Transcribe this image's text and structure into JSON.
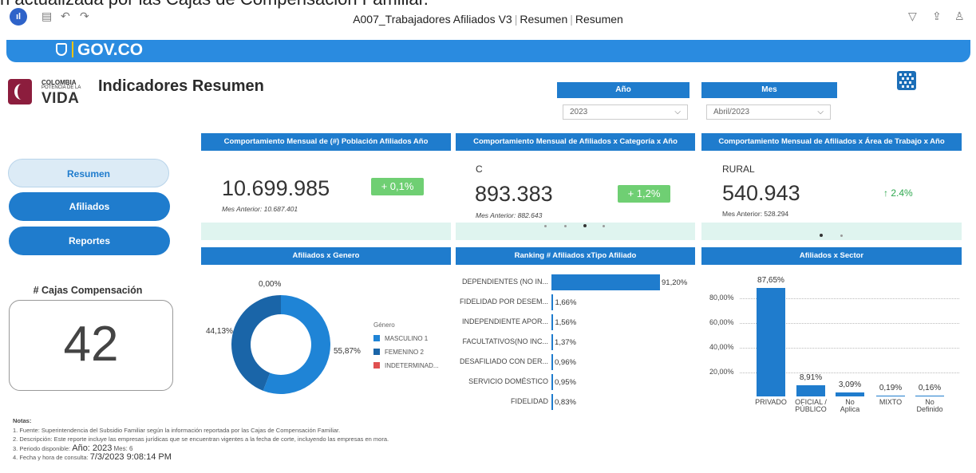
{
  "caption_fragment": "n actualizada por las Cajas de Compensacion Familiar.",
  "window": {
    "title": "A007_Trabajadores Afiliados V3",
    "crumb1": "Resumen",
    "crumb2": "Resumen",
    "app_icon": "app-logo-icon"
  },
  "gov": {
    "logo_text": "GOV.CO"
  },
  "brand": {
    "line1": "COLOMBIA",
    "line2": "POTENCIA DE LA",
    "line3": "VIDA"
  },
  "page_title": "Indicadores Resumen",
  "filters": {
    "year": {
      "label": "Año",
      "value": "2023"
    },
    "month": {
      "label": "Mes",
      "value": "Abril/2023"
    }
  },
  "nav": {
    "resumen": "Resumen",
    "afiliados": "Afiliados",
    "reportes": "Reportes"
  },
  "cajas": {
    "label": "# Cajas Compensación",
    "value": "42"
  },
  "kpi1": {
    "title": "Comportamiento Mensual de (#) Población  Afiliados Año",
    "value": "10.699.985",
    "delta": "+ 0,1%",
    "previous": "Mes Anterior: 10.687.401"
  },
  "kpi2": {
    "title": "Comportamiento Mensual de Afiliados x Categoría x Año",
    "category": "C",
    "value": "893.383",
    "delta": "+ 1,2%",
    "previous": "Mes Anterior: 882.643"
  },
  "kpi3": {
    "title": "Comportamiento Mensual de Afiliados x Área de Trabajo x Año",
    "category": "RURAL",
    "value": "540.943",
    "delta": "↑ 2.4%",
    "previous": "Mes Anterior: 528.294"
  },
  "genero": {
    "title": "Afiliados x Genero",
    "legend_title": "Género",
    "labels": {
      "top": "0,00%",
      "left": "44,13%",
      "right": "55,87%"
    },
    "legend": [
      "MASCULINO 1",
      "FEMENINO 2",
      "INDETERMINAD..."
    ],
    "colors": [
      "#1f84d6",
      "#1a65a8",
      "#e05050"
    ],
    "values": [
      55.87,
      44.13,
      0.0
    ]
  },
  "ranking": {
    "title": "Ranking # Afiliados xTipo Afiliado",
    "items": [
      {
        "label": "DEPENDIENTES (NO IN...",
        "value": 91.2,
        "text": "91,20%"
      },
      {
        "label": "FIDELIDAD POR DESEM...",
        "value": 1.66,
        "text": "1,66%"
      },
      {
        "label": "INDEPENDIENTE APOR...",
        "value": 1.56,
        "text": "1,56%"
      },
      {
        "label": "FACULTATIVOS(NO INC...",
        "value": 1.37,
        "text": "1,37%"
      },
      {
        "label": "DESAFILIADO CON DER...",
        "value": 0.96,
        "text": "0,96%"
      },
      {
        "label": "SERVICIO DOMÉSTICO",
        "value": 0.95,
        "text": "0,95%"
      },
      {
        "label": "FIDELIDAD",
        "value": 0.83,
        "text": "0,83%"
      }
    ]
  },
  "sector": {
    "title": "Afiliados x Sector",
    "yticks": [
      "80,00%",
      "60,00%",
      "40,00%",
      "20,00%"
    ],
    "items": [
      {
        "label1": "PRIVADO",
        "label2": "",
        "value": 87.65,
        "text": "87,65%"
      },
      {
        "label1": "OFICIAL /",
        "label2": "PÚBLICO",
        "value": 8.91,
        "text": "8,91%"
      },
      {
        "label1": "No",
        "label2": "Aplica",
        "value": 3.09,
        "text": "3,09%"
      },
      {
        "label1": "MIXTO",
        "label2": "",
        "value": 0.19,
        "text": "0,19%"
      },
      {
        "label1": "No",
        "label2": "Definido",
        "value": 0.16,
        "text": "0,16%"
      }
    ]
  },
  "chart_data": [
    {
      "type": "pie",
      "title": "Afiliados x Genero",
      "categories": [
        "MASCULINO 1",
        "FEMENINO 2",
        "INDETERMINAD..."
      ],
      "values": [
        55.87,
        44.13,
        0.0
      ]
    },
    {
      "type": "bar",
      "title": "Ranking # Afiliados xTipo Afiliado",
      "categories": [
        "DEPENDIENTES (NO IN...",
        "FIDELIDAD POR DESEM...",
        "INDEPENDIENTE APOR...",
        "FACULTATIVOS(NO INC...",
        "DESAFILIADO CON DER...",
        "SERVICIO DOMÉSTICO",
        "FIDELIDAD"
      ],
      "values": [
        91.2,
        1.66,
        1.56,
        1.37,
        0.96,
        0.95,
        0.83
      ]
    },
    {
      "type": "bar",
      "title": "Afiliados x Sector",
      "categories": [
        "PRIVADO",
        "OFICIAL / PÚBLICO",
        "No Aplica",
        "MIXTO",
        "No Definido"
      ],
      "values": [
        87.65,
        8.91,
        3.09,
        0.19,
        0.16
      ],
      "ylim": [
        0,
        100
      ]
    }
  ],
  "notes": {
    "title": "Notas:",
    "n1": "1. Fuente: Superintendencia del Subsidio Familiar según la información reportada por las Cajas de Compensación Familiar.",
    "n2": "2. Descripción: Este reporte incluye las empresas jurídicas que se encuentran vigentes a la fecha de corte, incluyendo las empresas en mora.",
    "n3_prefix": "3. Periodo disponible:",
    "n3_year": "Año: 2023",
    "n3_month": "Mes: 6",
    "n4_prefix": "4. Fecha y hora de consulta:",
    "n4_value": "7/3/2023 9:08:14 PM"
  }
}
